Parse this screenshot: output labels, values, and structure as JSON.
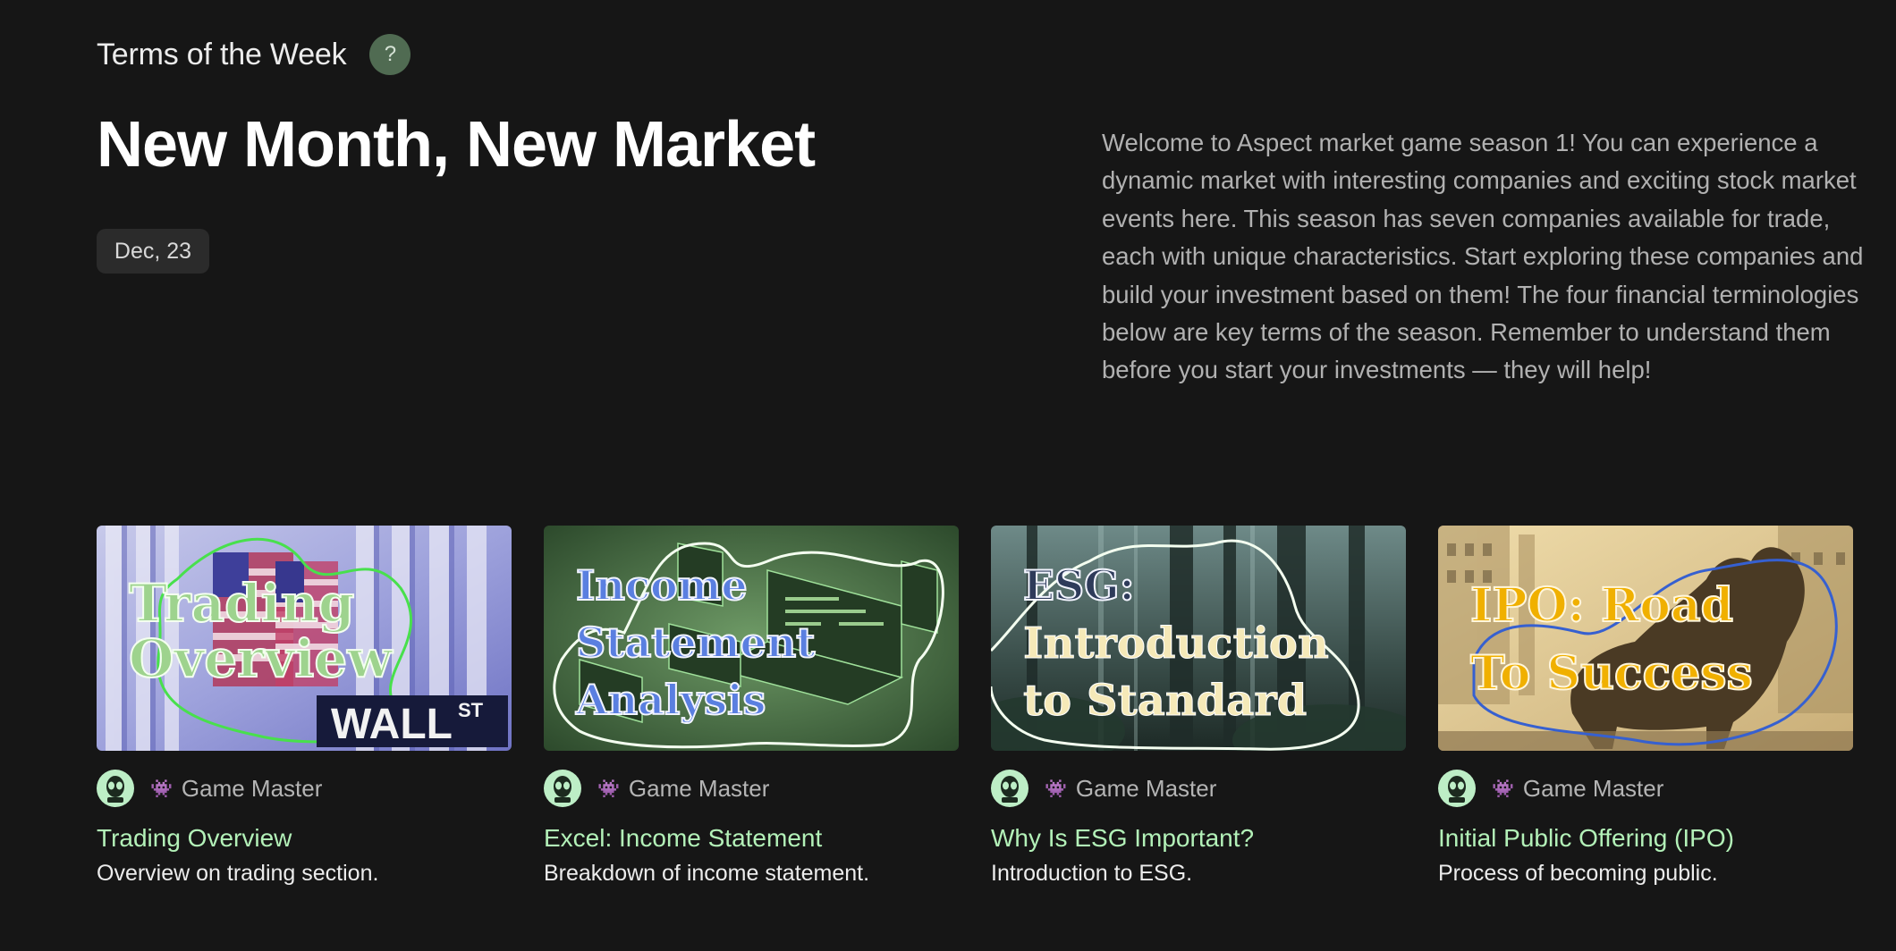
{
  "header": {
    "section_title": "Terms of the Week",
    "help_icon_glyph": "?"
  },
  "main": {
    "title": "New Month, New Market",
    "date": "Dec, 23",
    "intro": "Welcome to Aspect market game season 1! You can experience a dynamic market with interesting companies and exciting stock market events here. This season has seven companies available for trade, each with unique characteristics. Start exploring these companies and build your investment based on them! The four financial terminologies below are key terms of the season. Remember to understand them before you start your investments — they will help!"
  },
  "cards": [
    {
      "thumb_lines": [
        "Trading",
        "Overview"
      ],
      "thumb_extra": "WALL ST",
      "author_icon": "alien-monster-icon",
      "author": "Game Master",
      "title": "Trading Overview",
      "desc": "Overview on trading section."
    },
    {
      "thumb_lines": [
        "Income",
        "Statement",
        "Analysis"
      ],
      "author_icon": "alien-monster-icon",
      "author": "Game Master",
      "title": "Excel: Income Statement",
      "desc": "Breakdown of income statement."
    },
    {
      "thumb_lines": [
        "ESG:",
        "Introduction",
        "to Standard"
      ],
      "author_icon": "alien-monster-icon",
      "author": "Game Master",
      "title": "Why Is ESG Important?",
      "desc": "Introduction to ESG."
    },
    {
      "thumb_lines": [
        "IPO: Road",
        "To Success"
      ],
      "author_icon": "alien-monster-icon",
      "author": "Game Master",
      "title": "Initial Public Offering (IPO)",
      "desc": "Process of becoming public."
    }
  ],
  "colors": {
    "background": "#161616",
    "card_title": "#b3f1b8",
    "help_button": "#506b52",
    "avatar": "#bdeec6",
    "date_badge": "#2b2b2b"
  }
}
